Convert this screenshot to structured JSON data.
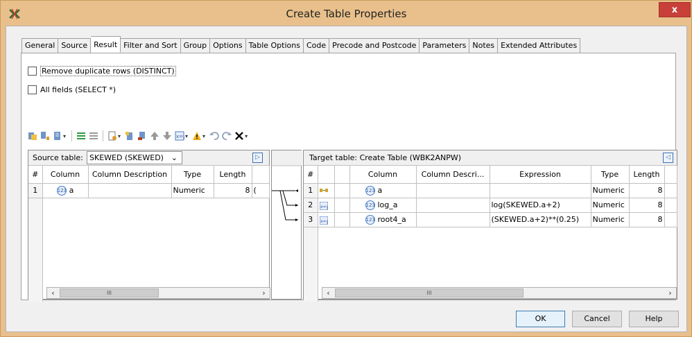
{
  "window": {
    "title": "Create Table Properties",
    "close_label": "x"
  },
  "tabs": [
    {
      "label": "General",
      "active": false
    },
    {
      "label": "Source",
      "active": false
    },
    {
      "label": "Result",
      "active": true
    },
    {
      "label": "Filter and Sort",
      "active": false
    },
    {
      "label": "Group",
      "active": false
    },
    {
      "label": "Options",
      "active": false
    },
    {
      "label": "Table Options",
      "active": false
    },
    {
      "label": "Code",
      "active": false
    },
    {
      "label": "Precode and Postcode",
      "active": false
    },
    {
      "label": "Parameters",
      "active": false
    },
    {
      "label": "Notes",
      "active": false
    },
    {
      "label": "Extended Attributes",
      "active": false
    }
  ],
  "options": {
    "distinct_label": "Remove duplicate rows (DISTINCT)",
    "distinct_checked": false,
    "select_all_label": "All fields (SELECT *)",
    "select_all_checked": false
  },
  "toolbar": {
    "icons": [
      "import-columns-icon",
      "map-columns-icon",
      "table-menu-icon",
      "align-left-icon",
      "align-right-icon",
      "properties-icon",
      "new-column-icon",
      "delete-column-icon",
      "move-up-icon",
      "move-down-icon",
      "expression-icon",
      "warning-icon",
      "undo-icon",
      "redo-icon",
      "delete-icon"
    ]
  },
  "source": {
    "label": "Source table:",
    "selected": "SKEWED (SKEWED)",
    "columns": [
      "#",
      "Column",
      "Column Description",
      "Type",
      "Length"
    ],
    "rows": [
      {
        "num": "1",
        "column": "a",
        "description": "",
        "type": "Numeric",
        "length": "8"
      }
    ]
  },
  "target": {
    "label": "Target table: Create Table (WBK2ANPW)",
    "columns": [
      "#",
      "",
      "",
      "Column",
      "Column Descri...",
      "Expression",
      "Type",
      "Length"
    ],
    "rows": [
      {
        "num": "1",
        "column": "a",
        "description": "",
        "expression": "",
        "type": "Numeric",
        "length": "8"
      },
      {
        "num": "2",
        "column": "log_a",
        "description": "",
        "expression": "log(SKEWED.a+2)",
        "type": "Numeric",
        "length": "8"
      },
      {
        "num": "3",
        "column": "root4_a",
        "description": "",
        "expression": "(SKEWED.a+2)**(0.25)",
        "type": "Numeric",
        "length": "8"
      }
    ]
  },
  "scrollbar": {
    "thumb_label": "III"
  },
  "footer": {
    "ok": "OK",
    "cancel": "Cancel",
    "help": "Help"
  },
  "colors": {
    "titlebar": "#e9c08b",
    "close": "#c7403a",
    "accent": "#3c7fb1"
  }
}
